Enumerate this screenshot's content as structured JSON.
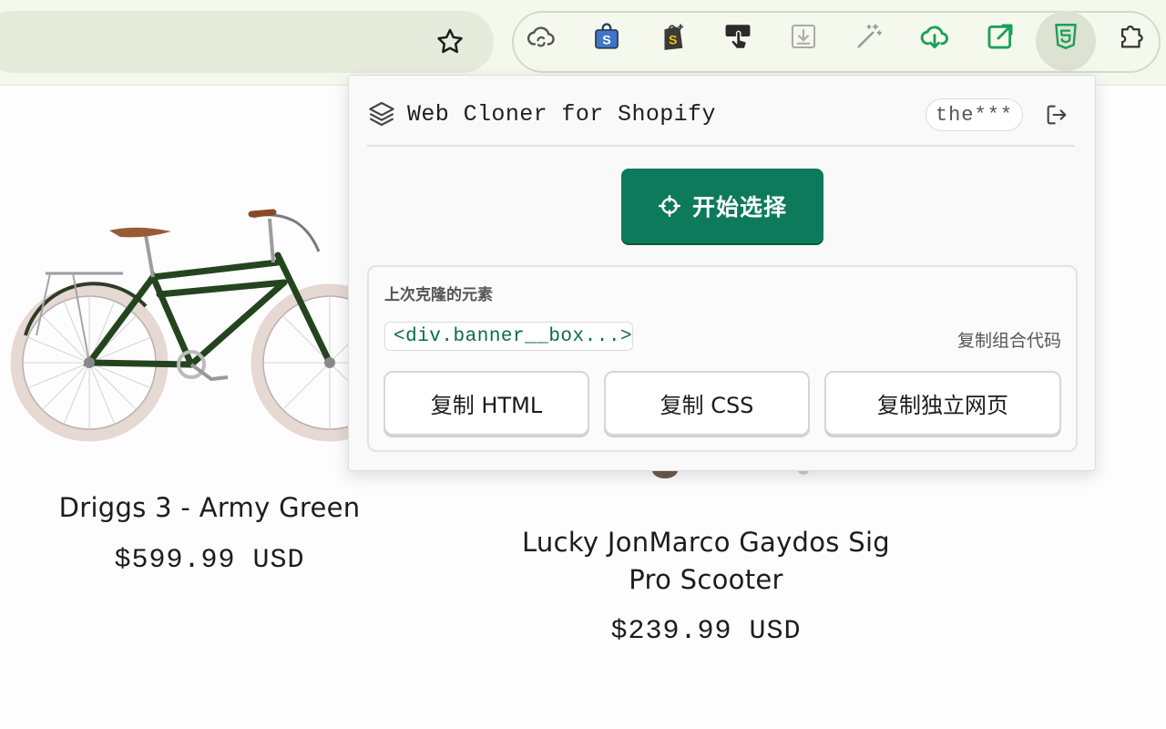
{
  "browser": {
    "extensions": [
      {
        "name": "cloud-sync-icon"
      },
      {
        "name": "shopping-bag-s-icon"
      },
      {
        "name": "shopify-icon"
      },
      {
        "name": "touch-cursor-icon"
      },
      {
        "name": "download-tray-icon"
      },
      {
        "name": "magic-wand-icon"
      },
      {
        "name": "cloud-download-icon"
      },
      {
        "name": "external-link-icon"
      },
      {
        "name": "html5-icon"
      },
      {
        "name": "puzzle-icon"
      }
    ]
  },
  "products": [
    {
      "title": "Driggs 3 - Army Green",
      "price": "$599.99 USD"
    },
    {
      "title_line1": "Lucky JonMarco Gaydos Sig",
      "title_line2": "Pro Scooter",
      "price": "$239.99 USD"
    }
  ],
  "popup": {
    "title": "Web Cloner for Shopify",
    "user": "the***",
    "start_label": "开始选择",
    "recent_label": "上次克隆的元素",
    "recent_element": "<div.banner__box...>",
    "copy_combo_label": "复制组合代码",
    "buttons": {
      "html": "复制 HTML",
      "css": "复制 CSS",
      "page": "复制独立网页"
    }
  },
  "colors": {
    "accent": "#0c7a5b",
    "toolbar_bg": "#f5f8ec",
    "extension_green": "#19a058",
    "bike_frame": "#24441f"
  }
}
